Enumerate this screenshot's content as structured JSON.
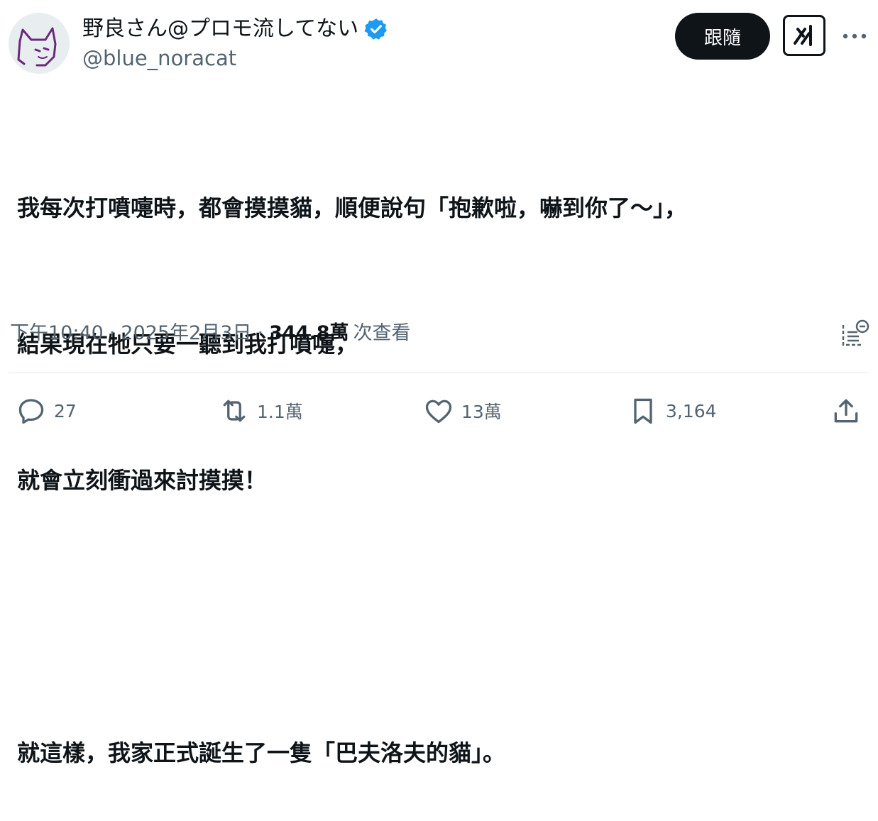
{
  "header": {
    "display_name": "野良さん@プロモ流してない",
    "handle": "@blue_noracat",
    "follow_label": "跟隨",
    "verified": true
  },
  "tweet": {
    "lines": [
      "我每次打噴嚏時，都會摸摸貓，順便說句「抱歉啦，嚇到你了～」，",
      "結果現在牠只要一聽到我打噴嚏，",
      "就會立刻衝過來討摸摸！",
      "",
      "就這樣，我家正式誕生了一隻「巴夫洛夫的貓」。"
    ]
  },
  "meta": {
    "time": "下午10:40",
    "date": "2025年2月3日",
    "separator": "·",
    "views_count": "344.8萬",
    "views_label": "次查看"
  },
  "actions": {
    "replies": "27",
    "retweets": "1.1萬",
    "likes": "13萬",
    "bookmarks": "3,164"
  },
  "colors": {
    "verified": "#1d9bf0",
    "primary_text": "#0f1419",
    "secondary_text": "#536471",
    "follow_bg": "#0f1419"
  }
}
